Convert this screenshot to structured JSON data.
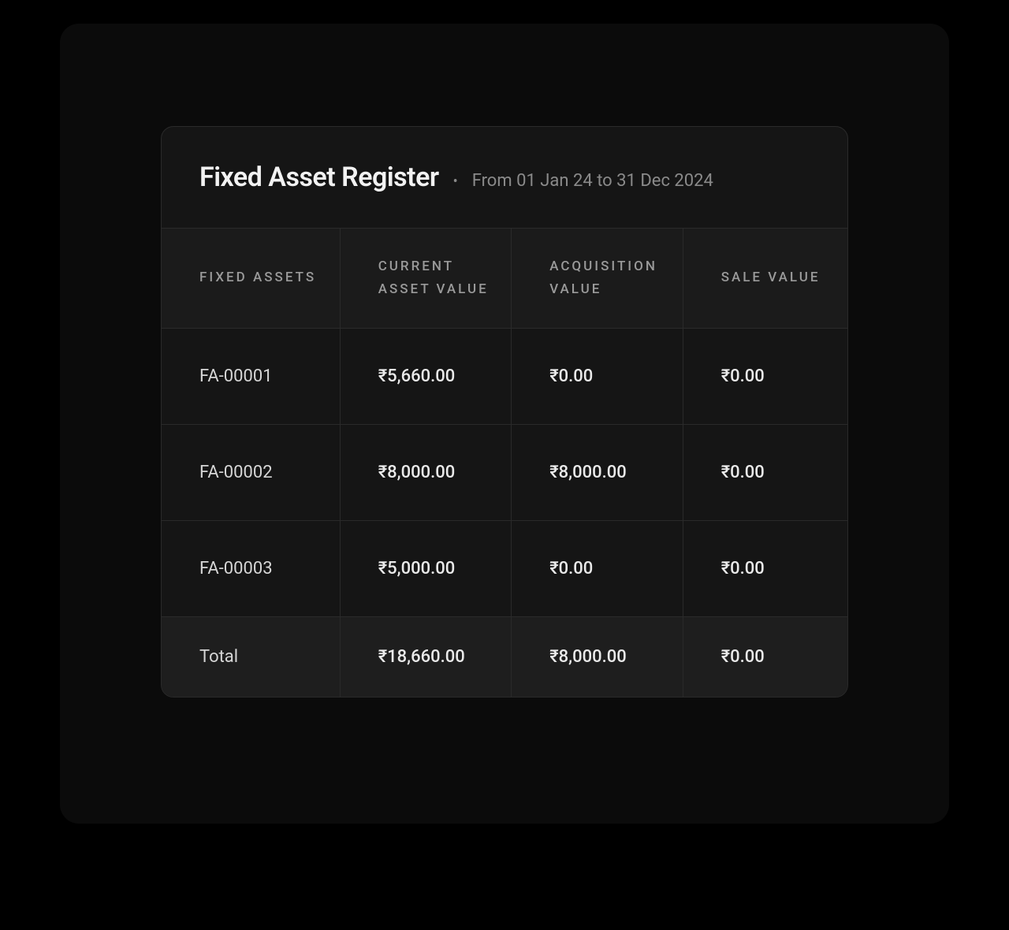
{
  "report": {
    "title": "Fixed Asset Register",
    "subtitle": "From 01 Jan 24 to 31 Dec 2024"
  },
  "table": {
    "headers": {
      "fixed_assets": "FIXED ASSETS",
      "current_value": "CURRENT ASSET VALUE",
      "acquisition_value": "ACQUISITION VALUE",
      "sale_value": "SALE VALUE"
    },
    "rows": [
      {
        "asset": "FA-00001",
        "current": "₹5,660.00",
        "acquisition": "₹0.00",
        "sale": "₹0.00"
      },
      {
        "asset": "FA-00002",
        "current": "₹8,000.00",
        "acquisition": "₹8,000.00",
        "sale": "₹0.00"
      },
      {
        "asset": "FA-00003",
        "current": "₹5,000.00",
        "acquisition": "₹0.00",
        "sale": "₹0.00"
      }
    ],
    "total": {
      "label": "Total",
      "current": "₹18,660.00",
      "acquisition": "₹8,000.00",
      "sale": "₹0.00"
    }
  }
}
